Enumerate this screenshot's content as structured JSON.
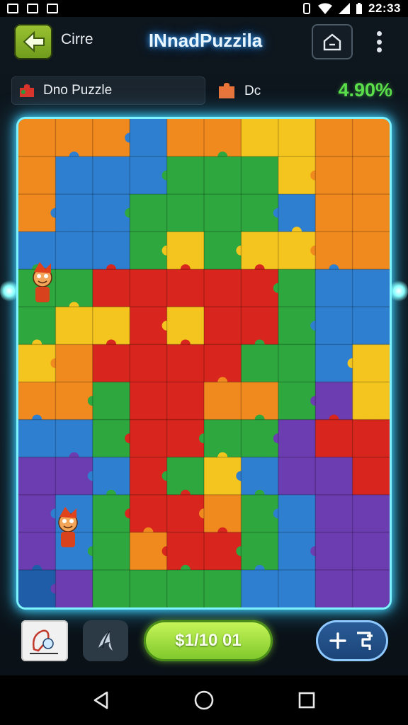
{
  "status_bar": {
    "time": "22:33",
    "icons": [
      "gallery-icon",
      "image-icon",
      "notification-icon",
      "vibrate-icon",
      "wifi-icon",
      "signal-icon",
      "battery-icon"
    ]
  },
  "header": {
    "back_label": "Cirre",
    "title": "INnadPuzzila",
    "home_icon": "home-icon",
    "menu_icon": "more-vert-icon"
  },
  "info": {
    "puzzle_name": "Dno Puzzle",
    "secondary_label": "Dc",
    "progress": "4.90%"
  },
  "controls": {
    "hint_icon": "hint-card-icon",
    "edge_icon": "edge-pieces-icon",
    "price_label": "$1/10 01",
    "add_icon": "add-piece-icon"
  },
  "nav": {
    "back": "nav-back-icon",
    "home": "nav-home-icon",
    "recents": "nav-recents-icon"
  },
  "colors": {
    "accent_green": "#5be04a",
    "board_glow": "#3fd4ff",
    "price_button": "#9bdc3a"
  }
}
